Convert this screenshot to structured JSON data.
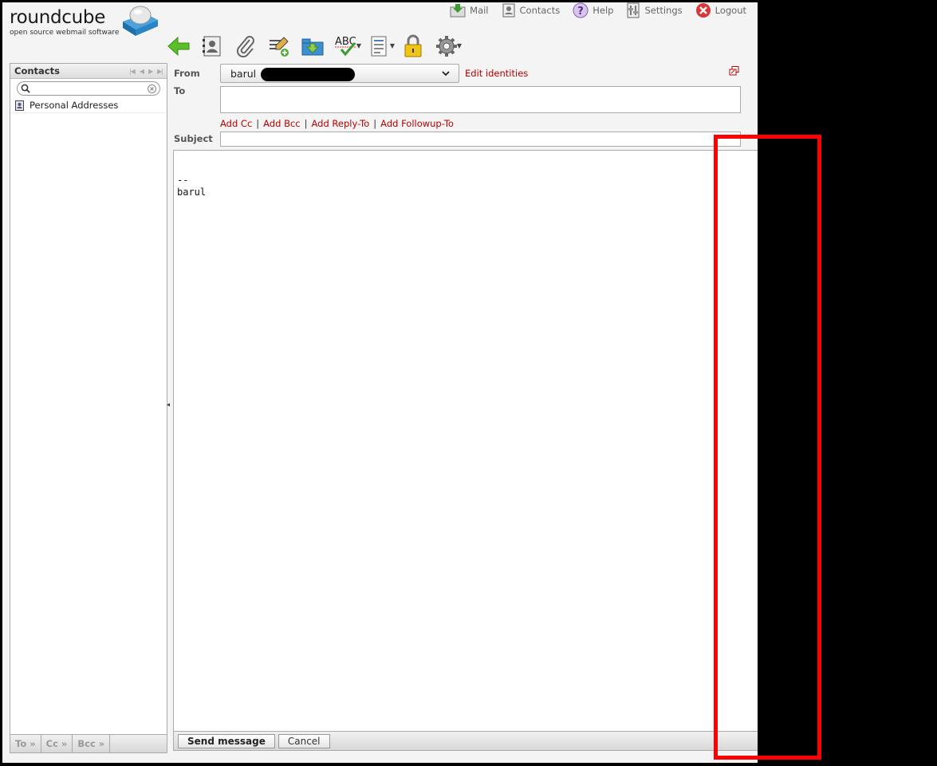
{
  "app": {
    "logo_text": "roundcube",
    "logo_tagline": "open source webmail software"
  },
  "topnav": [
    {
      "label": "Mail",
      "icon": "mail-icon"
    },
    {
      "label": "Contacts",
      "icon": "contacts-icon"
    },
    {
      "label": "Help",
      "icon": "help-icon"
    },
    {
      "label": "Settings",
      "icon": "settings-icon"
    },
    {
      "label": "Logout",
      "icon": "logout-icon"
    }
  ],
  "toolbar": [
    {
      "name": "back-button",
      "icon": "back-arrow-icon"
    },
    {
      "name": "address-book-button",
      "icon": "address-book-icon"
    },
    {
      "name": "attach-button",
      "icon": "paperclip-icon"
    },
    {
      "name": "signature-button",
      "icon": "signature-icon"
    },
    {
      "name": "save-draft-button",
      "icon": "save-icon"
    },
    {
      "name": "spellcheck-button",
      "icon": "spellcheck-icon",
      "label": "ABC"
    },
    {
      "name": "editor-type-button",
      "icon": "document-icon"
    },
    {
      "name": "encryption-button",
      "icon": "lock-icon"
    },
    {
      "name": "options-button",
      "icon": "gear-icon"
    }
  ],
  "contacts": {
    "title": "Contacts",
    "search_placeholder": "",
    "sources": [
      "Personal Addresses"
    ],
    "insert_buttons": [
      "To »",
      "Cc »",
      "Bcc »"
    ]
  },
  "compose": {
    "from_label": "From",
    "from_value": "barul",
    "edit_identities": "Edit identities",
    "to_label": "To",
    "to_value": "",
    "add_links": [
      "Add Cc",
      "Add Bcc",
      "Add Reply-To",
      "Add Followup-To"
    ],
    "separator": "|",
    "subject_label": "Subject",
    "subject_value": "",
    "body": "-- \nbarul"
  },
  "actions": {
    "send": "Send message",
    "cancel": "Cancel"
  },
  "colors": {
    "link": "#bb0000",
    "annotation": "#ff0000",
    "panel_bg": "#f4f4f4"
  }
}
